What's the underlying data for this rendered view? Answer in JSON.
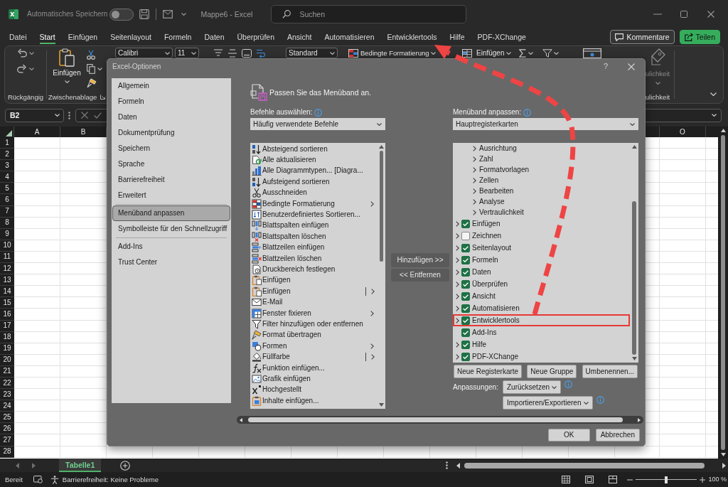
{
  "title_bar": {
    "autosave_label": "Automatisches Speichern",
    "autosave_on": false,
    "document_title": "Mappe6 - Excel",
    "search": {
      "placeholder": "Suchen"
    }
  },
  "ribbon_tabs": [
    {
      "label": "Datei",
      "selected": false
    },
    {
      "label": "Start",
      "selected": true
    },
    {
      "label": "Einfügen",
      "selected": false
    },
    {
      "label": "Seitenlayout",
      "selected": false
    },
    {
      "label": "Formeln",
      "selected": false
    },
    {
      "label": "Daten",
      "selected": false
    },
    {
      "label": "Überprüfen",
      "selected": false
    },
    {
      "label": "Ansicht",
      "selected": false
    },
    {
      "label": "Automatisieren",
      "selected": false
    },
    {
      "label": "Entwicklertools",
      "selected": false
    },
    {
      "label": "Hilfe",
      "selected": false
    },
    {
      "label": "PDF-XChange",
      "selected": false
    }
  ],
  "header_buttons": [
    {
      "label": "Kommentare",
      "kind": "outline"
    },
    {
      "label": "Teilen",
      "kind": "primary"
    }
  ],
  "ribbon": {
    "undo_group_label": "Rückgängig",
    "paste_label": "Einfügen",
    "clipboard_group_label": "Zwischenablage",
    "font_name": "Calibri",
    "font_size": "11",
    "number_format": "Standard",
    "conditional_formatting": "Bedingte Formatierung",
    "insert_cells": "Einfügen",
    "partial_group": {
      "button_label": "ulichkeit",
      "label": "ulichkeit"
    }
  },
  "formula_bar": {
    "name_box": "B2"
  },
  "sheet": {
    "columns_left": [
      "A",
      "B"
    ],
    "columns_right": [
      "O"
    ],
    "rows": [
      "1",
      "2",
      "3",
      "4",
      "5",
      "6",
      "7",
      "8",
      "9",
      "10",
      "11",
      "12",
      "13",
      "14",
      "15",
      "16",
      "17",
      "18",
      "19",
      "20",
      "21",
      "22",
      "23",
      "24",
      "25",
      "26",
      "27",
      "28"
    ]
  },
  "sheet_tabs": [
    {
      "label": "Tabelle1",
      "selected": true
    }
  ],
  "status_bar": {
    "mode": "Bereit",
    "accessibility": "Barrierefreiheit: Keine Probleme",
    "zoom_slider": {
      "level": 0.5
    },
    "zoom": "100 %"
  },
  "dialog": {
    "title": "Excel-Optionen",
    "help": "?",
    "nav_sections": [
      {
        "items": [
          {
            "label": "Allgemein",
            "selected": false
          },
          {
            "label": "Formeln",
            "selected": false
          },
          {
            "label": "Daten",
            "selected": false
          },
          {
            "label": "Dokumentprüfung",
            "selected": false
          },
          {
            "label": "Speichern",
            "selected": false
          },
          {
            "label": "Sprache",
            "selected": false
          },
          {
            "label": "Barrierefreiheit",
            "selected": false
          },
          {
            "label": "Erweitert",
            "selected": false
          }
        ]
      },
      {
        "items": [
          {
            "label": "Menüband anpassen",
            "selected": true
          },
          {
            "label": "Symbolleiste für den Schnellzugriff",
            "selected": false
          }
        ]
      },
      {
        "items": [
          {
            "label": "Add-Ins",
            "selected": false
          },
          {
            "label": "Trust Center",
            "selected": false
          }
        ]
      }
    ],
    "heading": "Passen Sie das Menüband an.",
    "commands": {
      "label": "Befehle auswählen:",
      "source": "Häufig verwendete Befehle",
      "items": [
        {
          "label": "Absteigend sortieren",
          "kind": "plain"
        },
        {
          "label": "Alle aktualisieren",
          "kind": "plain"
        },
        {
          "label": "Alle Diagrammtypen... [Diagra...",
          "kind": "plain"
        },
        {
          "label": "Aufsteigend sortieren",
          "kind": "plain"
        },
        {
          "label": "Ausschneiden",
          "kind": "plain"
        },
        {
          "label": "Bedingte Formatierung",
          "kind": "submenu"
        },
        {
          "label": "Benutzerdefiniertes Sortieren...",
          "kind": "plain"
        },
        {
          "label": "Blattspalten einfügen",
          "kind": "plain"
        },
        {
          "label": "Blattspalten löschen",
          "kind": "plain"
        },
        {
          "label": "Blattzeilen einfügen",
          "kind": "plain"
        },
        {
          "label": "Blattzeilen löschen",
          "kind": "plain"
        },
        {
          "label": "Druckbereich festlegen",
          "kind": "plain"
        },
        {
          "label": "Einfügen",
          "kind": "plain"
        },
        {
          "label": "Einfügen",
          "kind": "split"
        },
        {
          "label": "E-Mail",
          "kind": "plain"
        },
        {
          "label": "Fenster fixieren",
          "kind": "submenu"
        },
        {
          "label": "Filter hinzufügen oder entfernen",
          "kind": "plain"
        },
        {
          "label": "Format übertragen",
          "kind": "plain"
        },
        {
          "label": "Formen",
          "kind": "submenu"
        },
        {
          "label": "Füllfarbe",
          "kind": "split"
        },
        {
          "label": "Funktion einfügen...",
          "kind": "plain"
        },
        {
          "label": "Grafik einfügen",
          "kind": "plain"
        },
        {
          "label": "Hochgestellt",
          "kind": "plain"
        },
        {
          "label": "Inhalte einfügen...",
          "kind": "plain"
        }
      ]
    },
    "move_buttons": [
      "Hinzufügen >>",
      "<< Entfernen"
    ],
    "ribbon_layout": {
      "label": "Menüband anpassen:",
      "scope": "Hauptregisterkarten",
      "scrolled_tab_groups": [
        {
          "label": "Ausrichtung",
          "has_children": true
        },
        {
          "label": "Zahl",
          "has_children": true
        },
        {
          "label": "Formatvorlagen",
          "has_children": true
        },
        {
          "label": "Zellen",
          "has_children": true
        },
        {
          "label": "Bearbeiten",
          "has_children": true
        },
        {
          "label": "Analyse",
          "has_children": true
        },
        {
          "label": "Vertraulichkeit",
          "has_children": true
        }
      ],
      "tabs": [
        {
          "label": "Einfügen",
          "checked": true,
          "has_children": true,
          "marked": false
        },
        {
          "label": "Zeichnen",
          "checked": false,
          "has_children": true,
          "marked": false
        },
        {
          "label": "Seitenlayout",
          "checked": true,
          "has_children": true,
          "marked": false
        },
        {
          "label": "Formeln",
          "checked": true,
          "has_children": true,
          "marked": false
        },
        {
          "label": "Daten",
          "checked": true,
          "has_children": true,
          "marked": false
        },
        {
          "label": "Überprüfen",
          "checked": true,
          "has_children": true,
          "marked": false
        },
        {
          "label": "Ansicht",
          "checked": true,
          "has_children": true,
          "marked": false
        },
        {
          "label": "Automatisieren",
          "checked": true,
          "has_children": true,
          "marked": false
        },
        {
          "label": "Entwicklertools",
          "checked": true,
          "has_children": true,
          "marked": true
        },
        {
          "label": "Add-Ins",
          "checked": true,
          "has_children": false,
          "marked": false
        },
        {
          "label": "Hilfe",
          "checked": true,
          "has_children": true,
          "marked": false
        },
        {
          "label": "PDF-XChange",
          "checked": true,
          "has_children": true,
          "marked": false
        }
      ]
    },
    "tree_buttons": [
      "Neue Registerkarte",
      "Neue Gruppe",
      "Umbenennen..."
    ],
    "customizations": {
      "label": "Anpassungen:",
      "buttons": [
        "Zurücksetzen",
        "Importieren/Exportieren"
      ]
    },
    "footer_buttons": [
      "OK",
      "Abbrechen"
    ]
  }
}
